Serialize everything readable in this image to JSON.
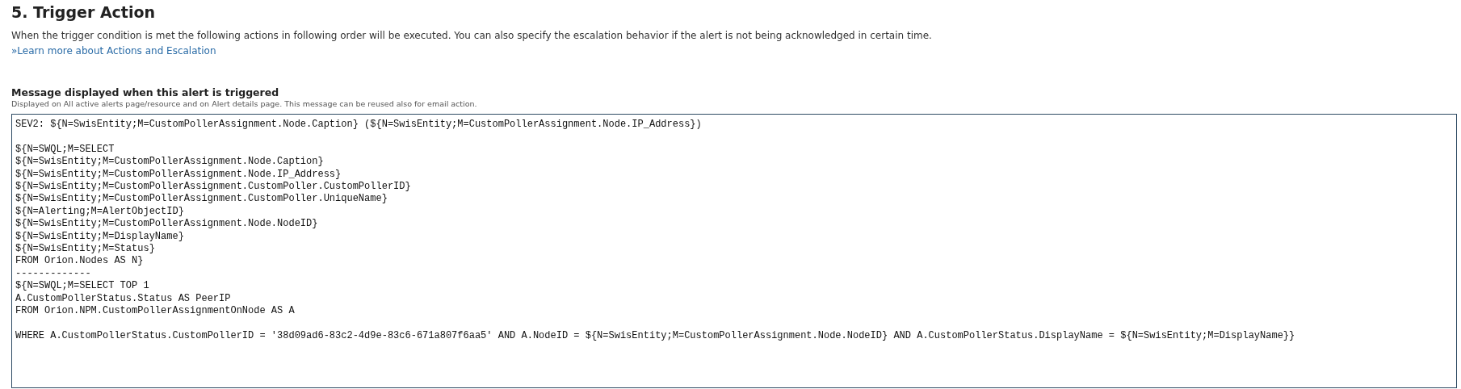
{
  "section": {
    "title": "5. Trigger Action",
    "description": "When the trigger condition is met the following actions in following order will be executed. You can also specify the escalation behavior if the alert is not being acknowledged in certain time.",
    "link": "»Learn more about Actions and Escalation"
  },
  "message": {
    "label": "Message displayed when this alert is triggered",
    "hint": "Displayed on All active alerts page/resource and on Alert details page. This message can be reused also for email action.",
    "value": "SEV2: ${N=SwisEntity;M=CustomPollerAssignment.Node.Caption} (${N=SwisEntity;M=CustomPollerAssignment.Node.IP_Address})\n\n${N=SWQL;M=SELECT\n${N=SwisEntity;M=CustomPollerAssignment.Node.Caption}\n${N=SwisEntity;M=CustomPollerAssignment.Node.IP_Address}\n${N=SwisEntity;M=CustomPollerAssignment.CustomPoller.CustomPollerID}\n${N=SwisEntity;M=CustomPollerAssignment.CustomPoller.UniqueName} \n${N=Alerting;M=AlertObjectID}\n${N=SwisEntity;M=CustomPollerAssignment.Node.NodeID}\n${N=SwisEntity;M=DisplayName}\n${N=SwisEntity;M=Status}\nFROM Orion.Nodes AS N}\n-------------\n${N=SWQL;M=SELECT TOP 1\nA.CustomPollerStatus.Status AS PeerIP\nFROM Orion.NPM.CustomPollerAssignmentOnNode AS A\n\nWHERE A.CustomPollerStatus.CustomPollerID = '38d09ad6-83c2-4d9e-83c6-671a807f6aa5' AND A.NodeID = ${N=SwisEntity;M=CustomPollerAssignment.Node.NodeID} AND A.CustomPollerStatus.DisplayName = ${N=SwisEntity;M=DisplayName}}"
  }
}
